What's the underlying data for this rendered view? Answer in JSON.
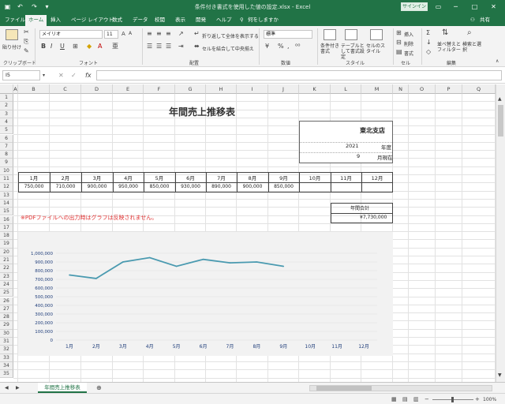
{
  "window": {
    "title": "条件付き書式を使用した値の設定.xlsx - Excel",
    "signin_label": "サインイン"
  },
  "tabs": [
    "ファイル",
    "ホーム",
    "挿入",
    "ページ レイアウト",
    "数式",
    "データ",
    "校閲",
    "表示",
    "開発",
    "ヘルプ"
  ],
  "tell_me": "何をしますか",
  "share_label": "共有",
  "ribbon": {
    "paste_label": "貼り付け",
    "clipboard_label": "クリップボード",
    "font_name": "メイリオ",
    "font_size": "11",
    "font_group_label": "フォント",
    "wrap_label": "折り返して全体を表示する",
    "merge_label": "セルを結合して中央揃え",
    "align_group_label": "配置",
    "number_format": "標準",
    "number_group_label": "数値",
    "cond_format_label": "条件付き書式",
    "table_format_label": "テーブルとして書式設定",
    "cell_style_label": "セルのスタイル",
    "styles_group_label": "スタイル",
    "insert_label": "挿入",
    "delete_label": "削除",
    "format_label": "書式",
    "cells_group_label": "セル",
    "sort_label": "並べ替えとフィルター",
    "find_label": "検索と選択",
    "edit_group_label": "編集"
  },
  "formula_bar": {
    "name_box": "I5",
    "formula": ""
  },
  "columns": [
    "A",
    "B",
    "C",
    "D",
    "E",
    "F",
    "G",
    "H",
    "I",
    "J",
    "K",
    "L",
    "M",
    "N",
    "O",
    "P",
    "Q"
  ],
  "rows": [
    "1",
    "2",
    "3",
    "4",
    "5",
    "6",
    "7",
    "8",
    "9",
    "10",
    "11",
    "12",
    "13",
    "14",
    "15",
    "16",
    "17",
    "18",
    "19",
    "20",
    "21",
    "22",
    "23",
    "24",
    "25",
    "26",
    "27",
    "28",
    "29",
    "30",
    "31",
    "32",
    "33",
    "34",
    "35"
  ],
  "sheet": {
    "title": "年間売上推移表",
    "branch": "東北支店",
    "year_value": "2021",
    "year_label": "年度",
    "month_value": "9",
    "month_label": "月現在",
    "months": [
      "1月",
      "2月",
      "3月",
      "4月",
      "5月",
      "6月",
      "7月",
      "8月",
      "9月",
      "10月",
      "11月",
      "12月"
    ],
    "sales": [
      "750,000",
      "710,000",
      "900,000",
      "950,000",
      "850,000",
      "930,000",
      "890,000",
      "900,000",
      "850,000",
      "",
      "",
      ""
    ],
    "total_label": "年間合計",
    "total_value": "¥7,730,000",
    "warning": "※PDFファイルへの出力時はグラフは反映されません。"
  },
  "chart_data": {
    "type": "line",
    "categories": [
      "1月",
      "2月",
      "3月",
      "4月",
      "5月",
      "6月",
      "7月",
      "8月",
      "9月",
      "10月",
      "11月",
      "12月"
    ],
    "values": [
      750000,
      710000,
      900000,
      950000,
      850000,
      930000,
      890000,
      900000,
      850000,
      null,
      null,
      null
    ],
    "ylim": [
      0,
      1000000
    ],
    "yticks": [
      "0",
      "100,000",
      "200,000",
      "300,000",
      "400,000",
      "500,000",
      "600,000",
      "700,000",
      "800,000",
      "900,000",
      "1,000,000"
    ],
    "color": "#4a9ab0",
    "grid": true
  },
  "sheet_tab": "年間売上推移表",
  "status": {
    "zoom": "100%"
  }
}
